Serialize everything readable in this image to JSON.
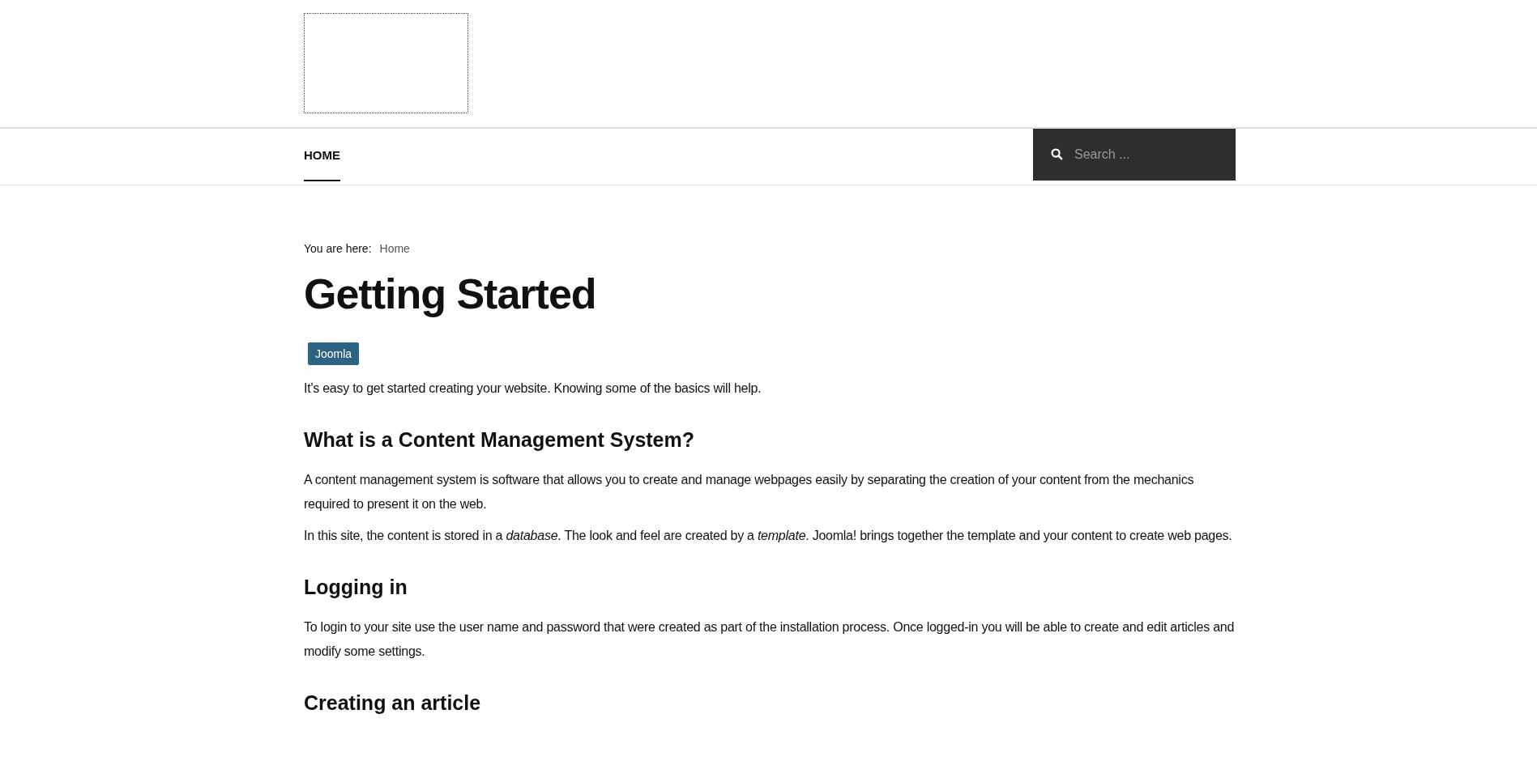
{
  "nav": {
    "items": [
      {
        "label": "HOME",
        "selected": true
      }
    ],
    "search": {
      "placeholder": "Search ..."
    }
  },
  "breadcrumb": {
    "label": "You are here:",
    "items": [
      "Home"
    ]
  },
  "article": {
    "title": "Getting Started",
    "tags": [
      {
        "label": "Joomla"
      }
    ],
    "intro": "It's easy to get started creating your website. Knowing some of the basics will help.",
    "sections": [
      {
        "heading": "What is a Content Management System?",
        "paragraphs": [
          "A content management system is software that allows you to create and manage webpages easily by separating the creation of your content from the mechanics required to present it on the web.",
          "In this site, the content is stored in a *database*. The look and feel are created by a *template*. Joomla! brings together the template and your content to create web pages."
        ]
      },
      {
        "heading": "Logging in",
        "paragraphs": [
          "To login to your site use the user name and password that were created as part of the installation process. Once logged-in you will be able to create and edit articles and modify some settings."
        ]
      },
      {
        "heading": "Creating an article"
      }
    ]
  }
}
